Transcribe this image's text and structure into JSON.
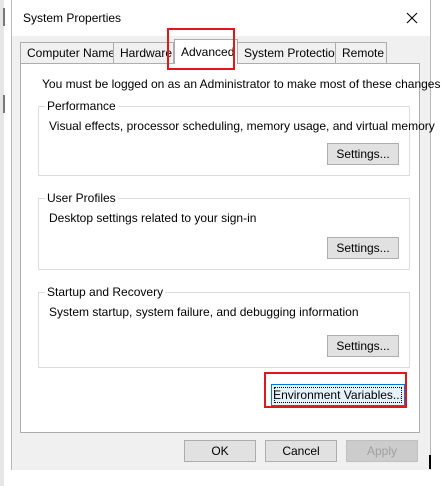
{
  "window": {
    "title": "System Properties"
  },
  "tabs": [
    {
      "label": "Computer Name"
    },
    {
      "label": "Hardware"
    },
    {
      "label": "Advanced"
    },
    {
      "label": "System Protection"
    },
    {
      "label": "Remote"
    }
  ],
  "active_tab": "Advanced",
  "advanced": {
    "note": "You must be logged on as an Administrator to make most of these changes.",
    "performance": {
      "legend": "Performance",
      "description": "Visual effects, processor scheduling, memory usage, and virtual memory",
      "button": "Settings..."
    },
    "user_profiles": {
      "legend": "User Profiles",
      "description": "Desktop settings related to your sign-in",
      "button": "Settings..."
    },
    "startup_recovery": {
      "legend": "Startup and Recovery",
      "description": "System startup, system failure, and debugging information",
      "button": "Settings..."
    },
    "environment_button": "Environment Variables..."
  },
  "footer": {
    "ok": "OK",
    "cancel": "Cancel",
    "apply": "Apply"
  },
  "colors": {
    "highlight": "#e01818",
    "button_face": "#e1e1e1",
    "dialog_bg": "#f0f0f0"
  },
  "icons": {
    "close": "close-icon"
  }
}
